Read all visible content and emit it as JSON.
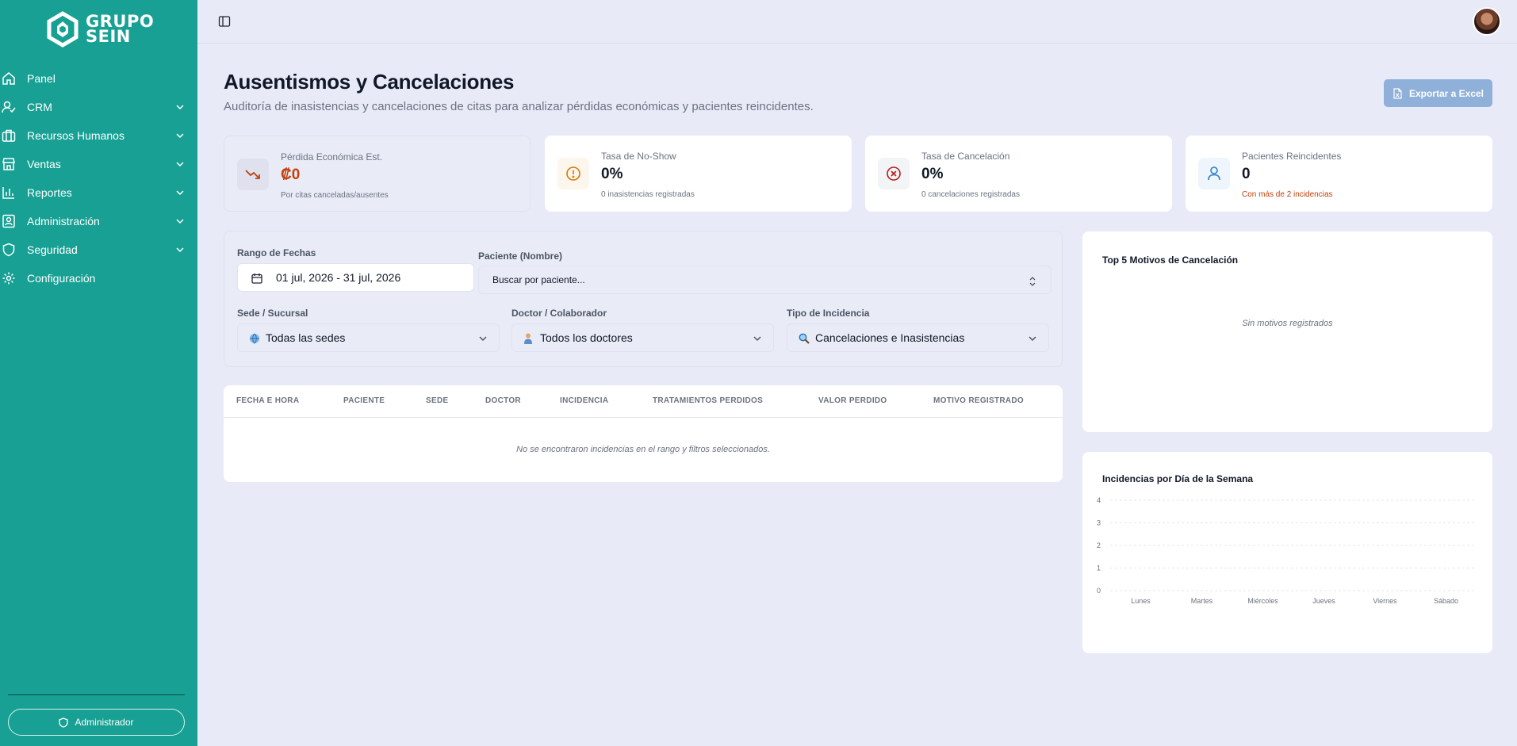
{
  "brand": {
    "line1": "GRUPO",
    "line2": "SEIN"
  },
  "sidebar": {
    "items": [
      {
        "label": "Panel",
        "icon": "home-icon",
        "expandable": false
      },
      {
        "label": "CRM",
        "icon": "user-check-icon",
        "expandable": true
      },
      {
        "label": "Recursos Humanos",
        "icon": "briefcase-icon",
        "expandable": true
      },
      {
        "label": "Ventas",
        "icon": "store-icon",
        "expandable": true
      },
      {
        "label": "Reportes",
        "icon": "bar-chart-icon",
        "expandable": true
      },
      {
        "label": "Administración",
        "icon": "contact-icon",
        "expandable": true
      },
      {
        "label": "Seguridad",
        "icon": "shield-icon",
        "expandable": true
      },
      {
        "label": "Configuración",
        "icon": "gear-icon",
        "expandable": false
      }
    ],
    "footer_button": "Administrador"
  },
  "header": {
    "title": "Ausentismos y Cancelaciones",
    "subtitle": "Auditoría de inasistencias y cancelaciones de citas para analizar pérdidas económicas y pacientes reincidentes.",
    "export_label": "Exportar a Excel"
  },
  "stats": [
    {
      "label": "Pérdida Económica Est.",
      "value": "₡0",
      "note": "Por citas canceladas/ausentes",
      "icon": "trending-down-icon"
    },
    {
      "label": "Tasa de No-Show",
      "value": "0%",
      "note": "0 inasistencias registradas",
      "icon": "alert-circle-icon"
    },
    {
      "label": "Tasa de Cancelación",
      "value": "0%",
      "note": "0 cancelaciones registradas",
      "icon": "x-circle-icon"
    },
    {
      "label": "Pacientes Reincidentes",
      "value": "0",
      "note": "Con más de 2 incidencias",
      "icon": "user-icon"
    }
  ],
  "filters": {
    "date_label": "Rango de Fechas",
    "date_value": "01 jul, 2026 - 31 jul, 2026",
    "patient_label": "Paciente (Nombre)",
    "patient_placeholder": "Buscar por paciente...",
    "branch_label": "Sede / Sucursal",
    "branch_value": "Todas las sedes",
    "doctor_label": "Doctor / Colaborador",
    "doctor_value": "Todos los doctores",
    "type_label": "Tipo de Incidencia",
    "type_value": "Cancelaciones e Inasistencias"
  },
  "table": {
    "columns": [
      "FECHA E HORA",
      "PACIENTE",
      "SEDE",
      "DOCTOR",
      "INCIDENCIA",
      "TRATAMIENTOS PERDIDOS",
      "VALOR PERDIDO",
      "MOTIVO REGISTRADO"
    ],
    "empty_message": "No se encontraron incidencias en el rango y filtros seleccionados."
  },
  "top_reasons": {
    "title": "Top 5 Motivos de Cancelación",
    "empty_message": "Sin motivos registrados"
  },
  "chart_data": {
    "type": "bar",
    "title": "Incidencias por Día de la Semana",
    "categories": [
      "Lunes",
      "Martes",
      "Miércoles",
      "Jueves",
      "Viernes",
      "Sábado"
    ],
    "values": [
      0,
      0,
      0,
      0,
      0,
      0
    ],
    "yticks": [
      0,
      1,
      2,
      3,
      4
    ],
    "ylim": [
      0,
      4
    ],
    "grid": true
  },
  "colors": {
    "sidebar": "#17a093",
    "loss": "#c2410c",
    "export": "#8fb0d8",
    "background": "#e8ebf7"
  }
}
